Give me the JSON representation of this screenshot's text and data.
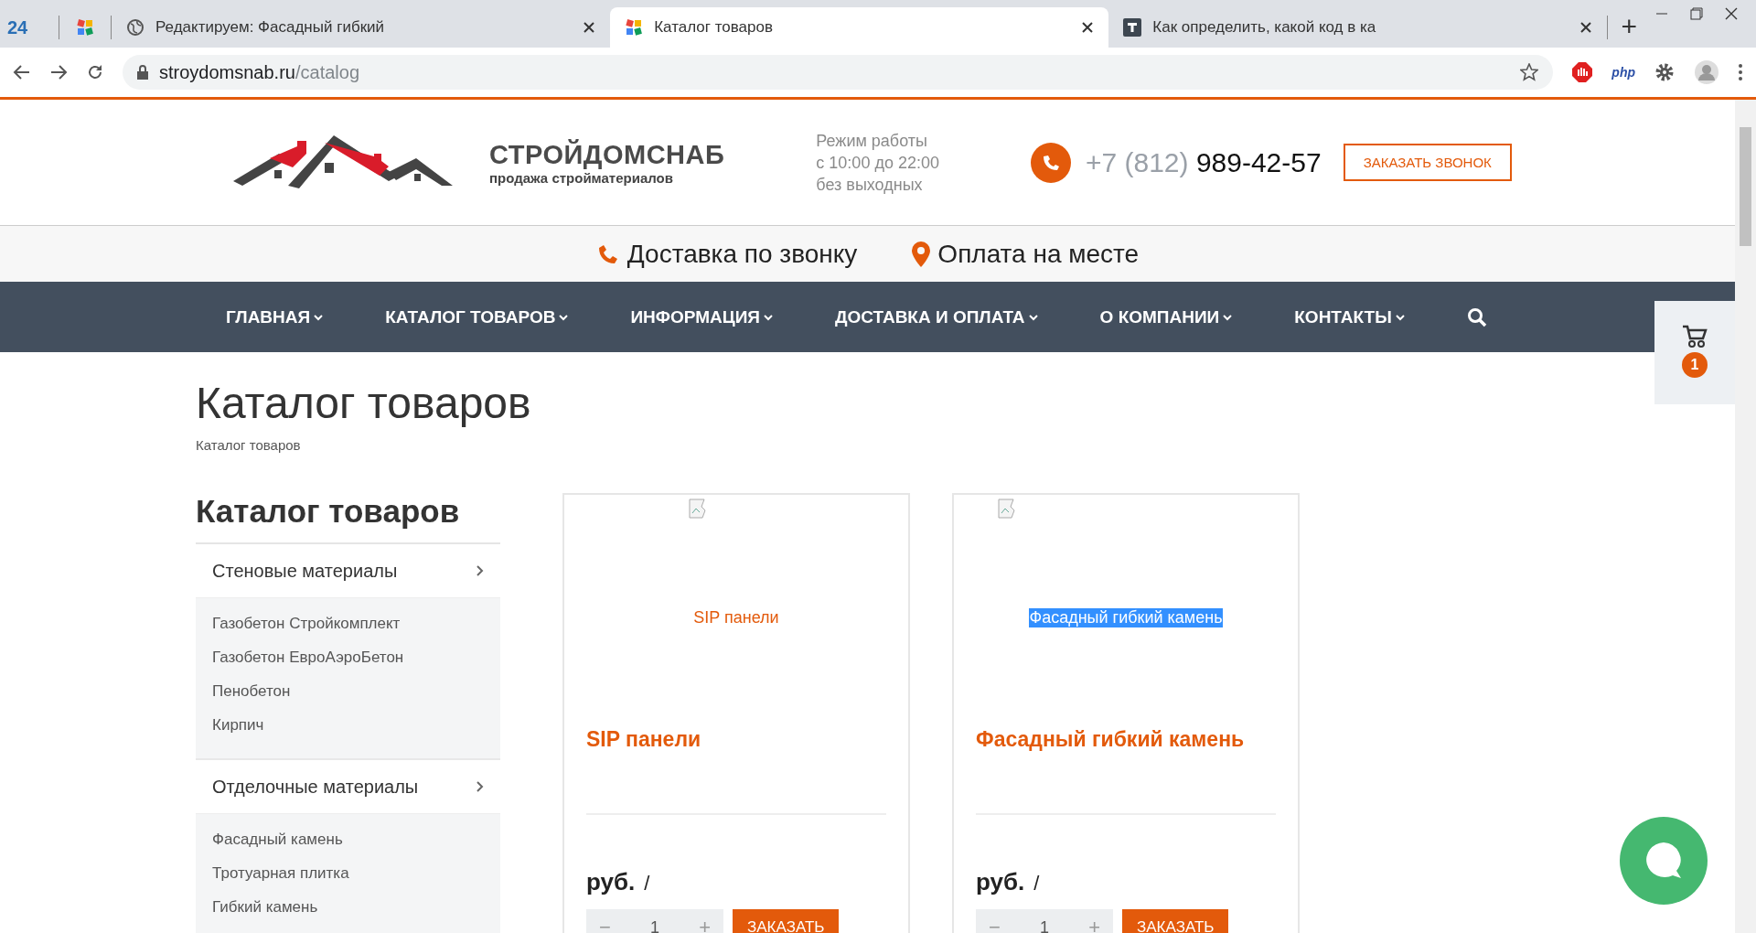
{
  "browser": {
    "tabs": [
      {
        "kind": "pinned",
        "label": "24",
        "selected": false
      },
      {
        "kind": "pinned-tiles",
        "selected": false
      },
      {
        "kind": "globe",
        "label": "Редактируем: Фасадный гибкий",
        "selected": false
      },
      {
        "kind": "tiles",
        "label": "Каталог товаров",
        "selected": true
      },
      {
        "kind": "badge",
        "label": "Как определить, какой код в ка",
        "selected": false
      }
    ],
    "new_tab": "+",
    "address": {
      "host": "stroydomsnab.ru",
      "path": "/catalog"
    },
    "extensions": [
      {
        "kind": "stop"
      },
      {
        "kind": "text",
        "label": "php"
      },
      {
        "kind": "gear"
      }
    ]
  },
  "header": {
    "brand": "СТРОЙДОМСНАБ",
    "tagline": "продажа стройматериалов",
    "hours": [
      "Режим работы",
      "с 10:00 до 22:00",
      "без выходных"
    ],
    "phone_code": "+7 (812)",
    "phone_number": "989-42-57",
    "callback_button": "ЗАКАЗАТЬ ЗВОНОК"
  },
  "features": [
    {
      "kind": "phone",
      "label": "Доставка по звонку"
    },
    {
      "kind": "pin",
      "label": "Оплата на месте"
    }
  ],
  "nav": {
    "items": [
      "ГЛАВНАЯ",
      "КАТАЛОГ ТОВАРОВ",
      "ИНФОРМАЦИЯ",
      "ДОСТАВКА И ОПЛАТА",
      "О КОМПАНИИ",
      "КОНТАКТЫ"
    ]
  },
  "page": {
    "title": "Каталог товаров",
    "breadcrumb": "Каталог товаров"
  },
  "sidebar": {
    "title": "Каталог товаров",
    "sections": [
      {
        "label": "Стеновые материалы",
        "children": [
          {
            "label": "Газобетон Стройкомплект"
          },
          {
            "label": "Газобетон ЕвроАэроБетон"
          },
          {
            "label": "Пенобетон"
          },
          {
            "label": "Кирпич"
          }
        ]
      },
      {
        "label": "Отделочные материалы",
        "children": [
          {
            "label": "Фасадный камень"
          },
          {
            "label": "Тротуарная плитка"
          },
          {
            "label": "Гибкий камень"
          }
        ]
      }
    ]
  },
  "products": [
    {
      "image_alt": "SIP панели",
      "alt_selected": false,
      "name": "SIP панели",
      "price": "руб.",
      "price_suffix": "/",
      "decrement": "−",
      "quantity": "1",
      "increment": "+",
      "order_button": "ЗАКАЗАТЬ"
    },
    {
      "image_alt": "Фасадный гибкий камень",
      "alt_selected": true,
      "name": "Фасадный гибкий камень",
      "price": "руб.",
      "price_suffix": "/",
      "decrement": "−",
      "quantity": "1",
      "increment": "+",
      "order_button": "ЗАКАЗАТЬ"
    }
  ],
  "cart": {
    "count": "1"
  }
}
